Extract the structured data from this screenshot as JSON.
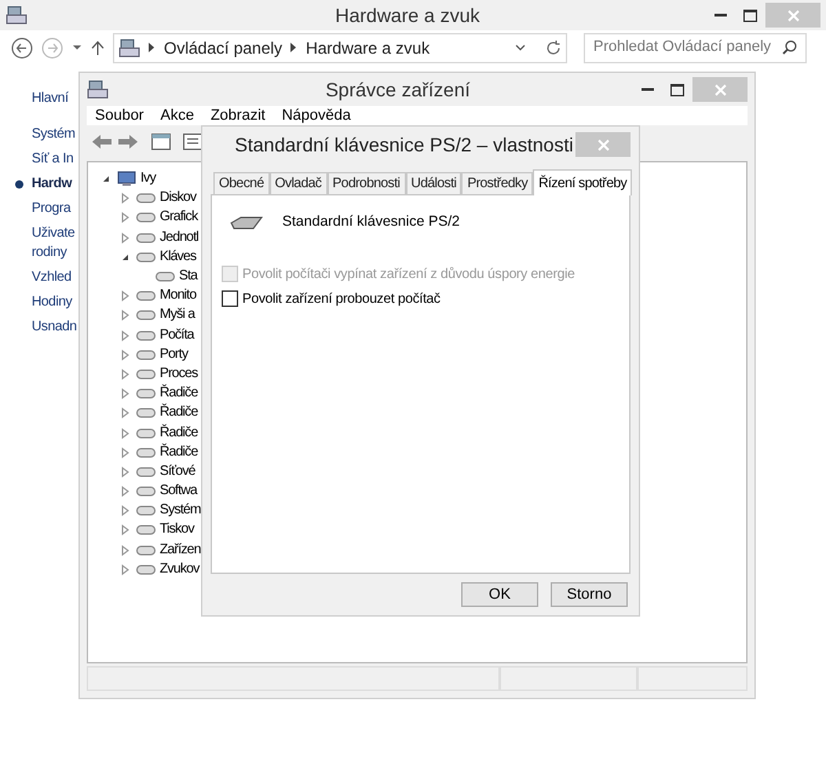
{
  "main_window": {
    "title": "Hardware a zvuk",
    "breadcrumb": [
      "Ovládací panely",
      "Hardware a zvuk"
    ],
    "search": {
      "placeholder": "Prohledat Ovládací panely"
    },
    "sidebar": [
      {
        "lines": [
          "Hlavní"
        ],
        "selected": false
      },
      {
        "lines": [
          "Systém"
        ],
        "selected": false
      },
      {
        "lines": [
          "Síť a In"
        ],
        "selected": false
      },
      {
        "lines": [
          "Hardw"
        ],
        "selected": true
      },
      {
        "lines": [
          "Progra"
        ],
        "selected": false
      },
      {
        "lines": [
          "Uživate",
          "rodiny"
        ],
        "selected": false
      },
      {
        "lines": [
          "Vzhled"
        ],
        "selected": false
      },
      {
        "lines": [
          "Hodiny"
        ],
        "selected": false
      },
      {
        "lines": [
          "Usnadn"
        ],
        "selected": false
      }
    ]
  },
  "device_manager": {
    "title": "Správce zařízení",
    "menu": [
      "Soubor",
      "Akce",
      "Zobrazit",
      "Nápověda"
    ],
    "tree": [
      {
        "label": "Ivy",
        "expanded": true,
        "children": [
          {
            "label": "Diskov",
            "expanded": false
          },
          {
            "label": "Grafick",
            "expanded": false
          },
          {
            "label": "Jednotl",
            "expanded": false
          },
          {
            "label": "Kláves",
            "expanded": true,
            "children": [
              {
                "label": "Sta"
              }
            ]
          },
          {
            "label": "Monito",
            "expanded": false
          },
          {
            "label": "Myši a",
            "expanded": false
          },
          {
            "label": "Počíta",
            "expanded": false
          },
          {
            "label": "Porty",
            "expanded": false
          },
          {
            "label": "Proces",
            "expanded": false
          },
          {
            "label": "Řadiče",
            "expanded": false
          },
          {
            "label": "Řadiče",
            "expanded": false
          },
          {
            "label": "Řadiče",
            "expanded": false
          },
          {
            "label": "Řadiče",
            "expanded": false
          },
          {
            "label": "Síťové",
            "expanded": false
          },
          {
            "label": "Softwa",
            "expanded": false
          },
          {
            "label": "Systém",
            "expanded": false
          },
          {
            "label": "Tiskov",
            "expanded": false
          },
          {
            "label": "Zařízen",
            "expanded": false
          },
          {
            "label": "Zvukov",
            "expanded": false
          }
        ]
      }
    ]
  },
  "dialog": {
    "title": "Standardní klávesnice PS/2 – vlastnosti",
    "tabs": [
      {
        "label": "Obecné",
        "selected": false
      },
      {
        "label": "Ovladač",
        "selected": false
      },
      {
        "label": "Podrobnosti",
        "selected": false
      },
      {
        "label": "Události",
        "selected": false
      },
      {
        "label": "Prostředky",
        "selected": false
      },
      {
        "label": "Řízení spotřeby",
        "selected": true
      }
    ],
    "device_name": "Standardní klávesnice PS/2",
    "options": [
      {
        "label": "Povolit počítači vypínat zařízení z důvodu úspory energie",
        "checked": false,
        "disabled": true
      },
      {
        "label": "Povolit zařízení probouzet počítač",
        "checked": false,
        "disabled": false
      }
    ],
    "buttons": [
      "OK",
      "Storno"
    ]
  }
}
